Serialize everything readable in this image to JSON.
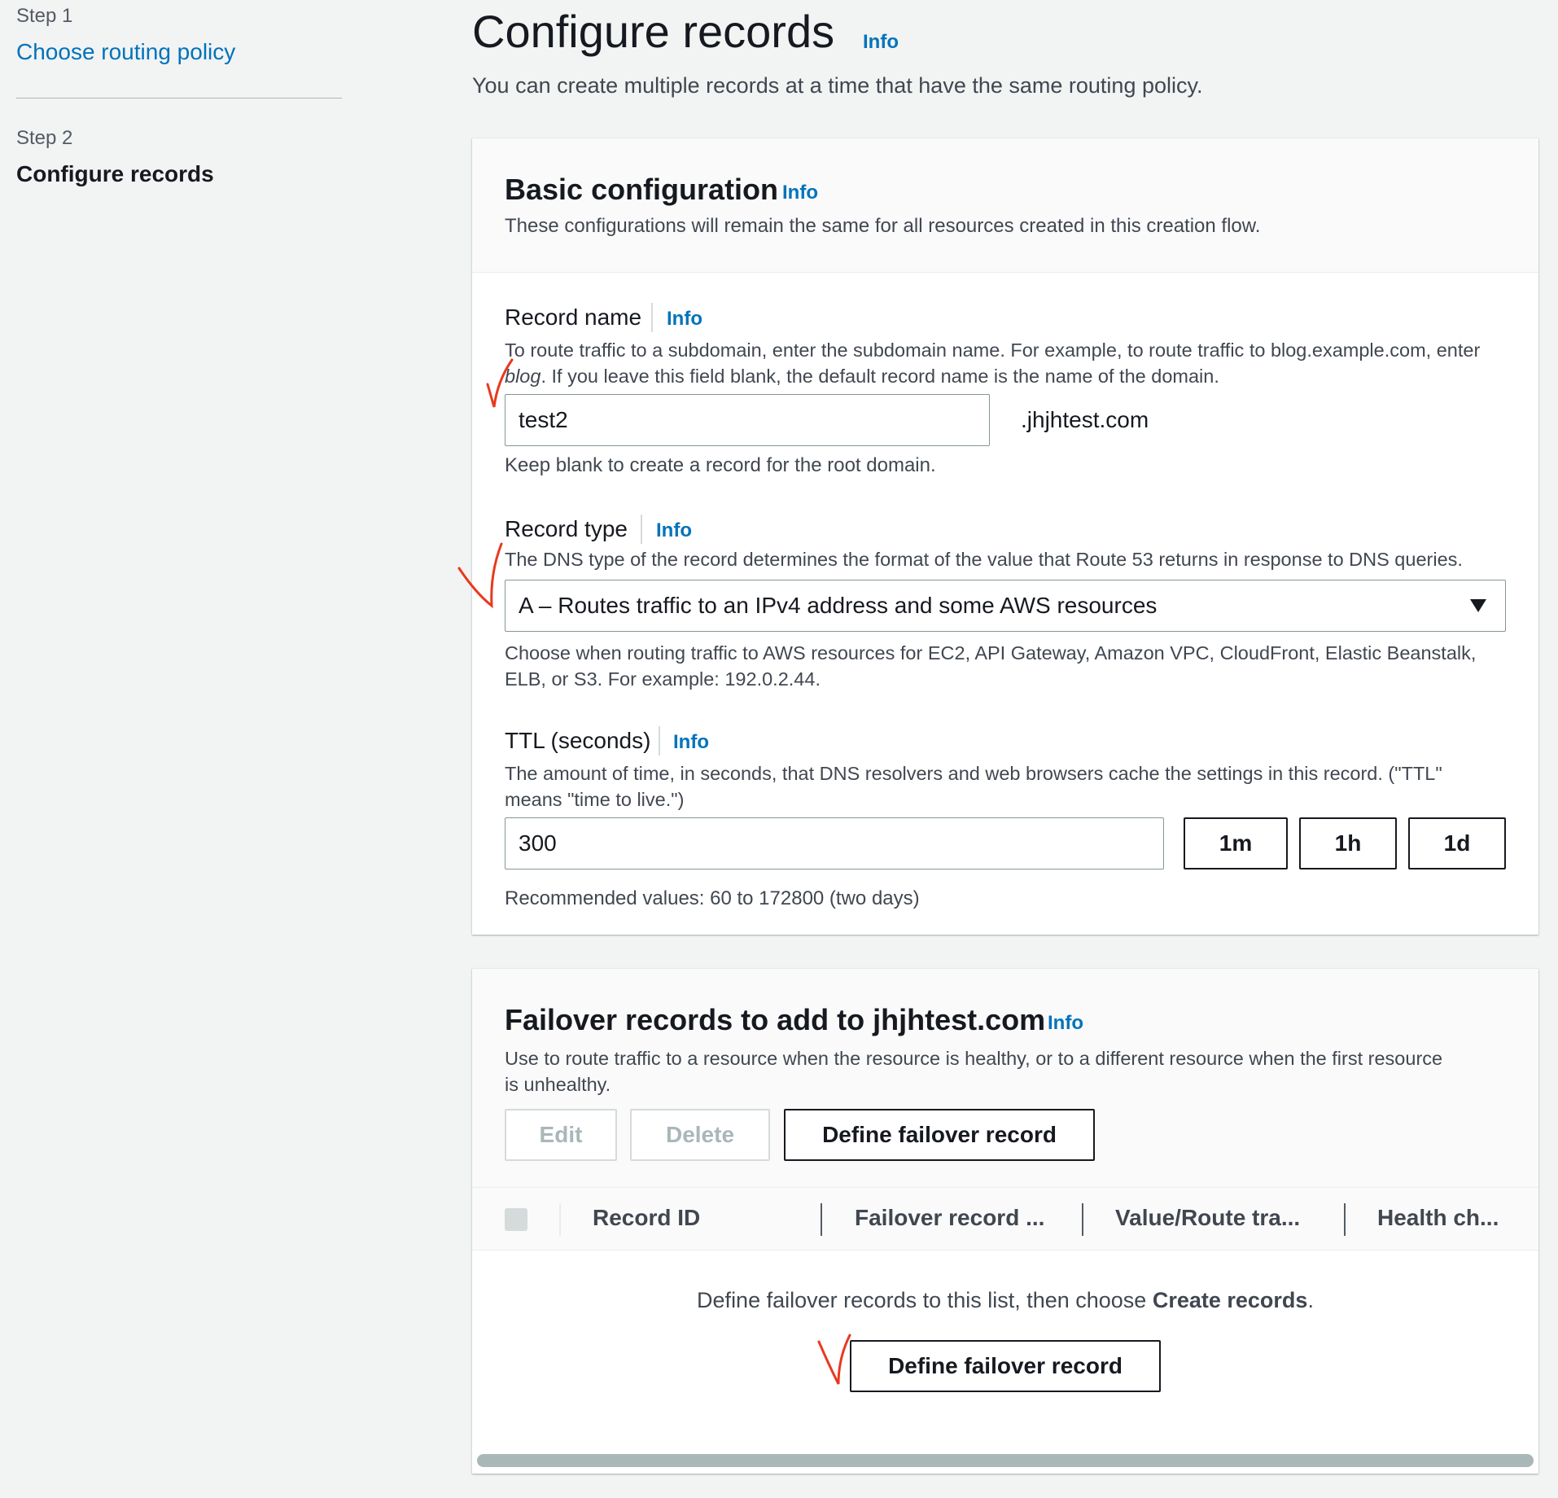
{
  "wizard": {
    "step1": {
      "label": "Step 1",
      "title": "Choose routing policy"
    },
    "step2": {
      "label": "Step 2",
      "title": "Configure records"
    }
  },
  "page": {
    "title": "Configure records",
    "info": "Info",
    "description": "You can create multiple records at a time that have the same routing policy."
  },
  "basic": {
    "title": "Basic configuration",
    "info": "Info",
    "description": "These configurations will remain the same for all resources created in this creation flow.",
    "record_name": {
      "label": "Record name",
      "info": "Info",
      "desc_part1": "To route traffic to a subdomain, enter the subdomain name. For example, to route traffic to blog.example.com, enter ",
      "desc_italic": "blog",
      "desc_part2": ". If you leave this field blank, the default record name is the name of the domain.",
      "value": "test2",
      "suffix": ".jhjhtest.com",
      "hint": "Keep blank to create a record for the root domain."
    },
    "record_type": {
      "label": "Record type",
      "info": "Info",
      "description": "The DNS type of the record determines the format of the value that Route 53 returns in response to DNS queries.",
      "selected": "A – Routes traffic to an IPv4 address and some AWS resources",
      "hint_line1": "Choose when routing traffic to AWS resources for EC2, API Gateway, Amazon VPC, CloudFront, Elastic Beanstalk,",
      "hint_line2": "ELB, or S3. For example: 192.0.2.44."
    },
    "ttl": {
      "label": "TTL (seconds)",
      "info": "Info",
      "desc_line1": "The amount of time, in seconds, that DNS resolvers and web browsers cache the settings in this record. (\"TTL\"",
      "desc_line2": "means \"time to live.\")",
      "value": "300",
      "presets": [
        "1m",
        "1h",
        "1d"
      ],
      "hint": "Recommended values: 60 to 172800 (two days)"
    }
  },
  "failover": {
    "title": "Failover records to add to jhjhtest.com",
    "info": "Info",
    "desc_line1": "Use to route traffic to a resource when the resource is healthy, or to a different resource when the first resource",
    "desc_line2": "is unhealthy.",
    "edit": "Edit",
    "delete": "Delete",
    "define": "Define failover record",
    "columns": [
      "Record ID",
      "Failover record ...",
      "Value/Route tra...",
      "Health ch..."
    ],
    "empty_part1": "Define failover records to this list, then choose ",
    "empty_bold": "Create records",
    "empty_part2": ".",
    "empty_button": "Define failover record"
  },
  "colors": {
    "accent": "#0073bb",
    "annotation": "#e8391f"
  }
}
